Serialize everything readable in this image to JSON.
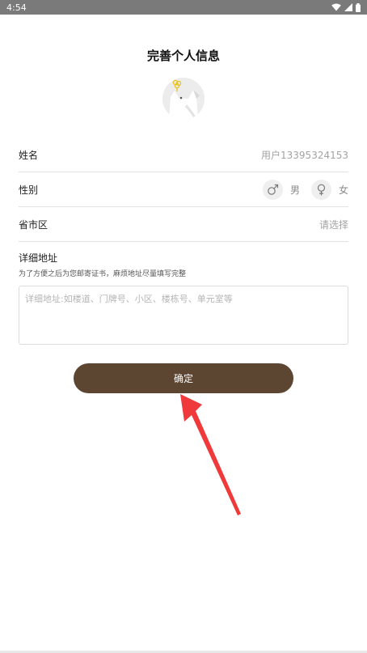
{
  "status_bar": {
    "time": "4:54",
    "icons": [
      "wifi-icon",
      "signal-icon",
      "battery-icon"
    ]
  },
  "page": {
    "title": "完善个人信息"
  },
  "form": {
    "name": {
      "label": "姓名",
      "value": "用户13395324153"
    },
    "gender": {
      "label": "性别",
      "options": [
        {
          "icon": "male-icon",
          "label": "男"
        },
        {
          "icon": "female-icon",
          "label": "女"
        }
      ]
    },
    "region": {
      "label": "省市区",
      "value": "请选择"
    },
    "address": {
      "label": "详细地址",
      "hint": "为了方便之后为您邮寄证书，麻烦地址尽量填写完整",
      "placeholder": "详细地址:如楼道、门牌号、小区、楼栋号、单元室等"
    }
  },
  "confirm_button": {
    "label": "确定"
  },
  "colors": {
    "button_bg": "#5c4632",
    "annotation_arrow": "#f0393a",
    "divider": "#e2e2e2"
  }
}
